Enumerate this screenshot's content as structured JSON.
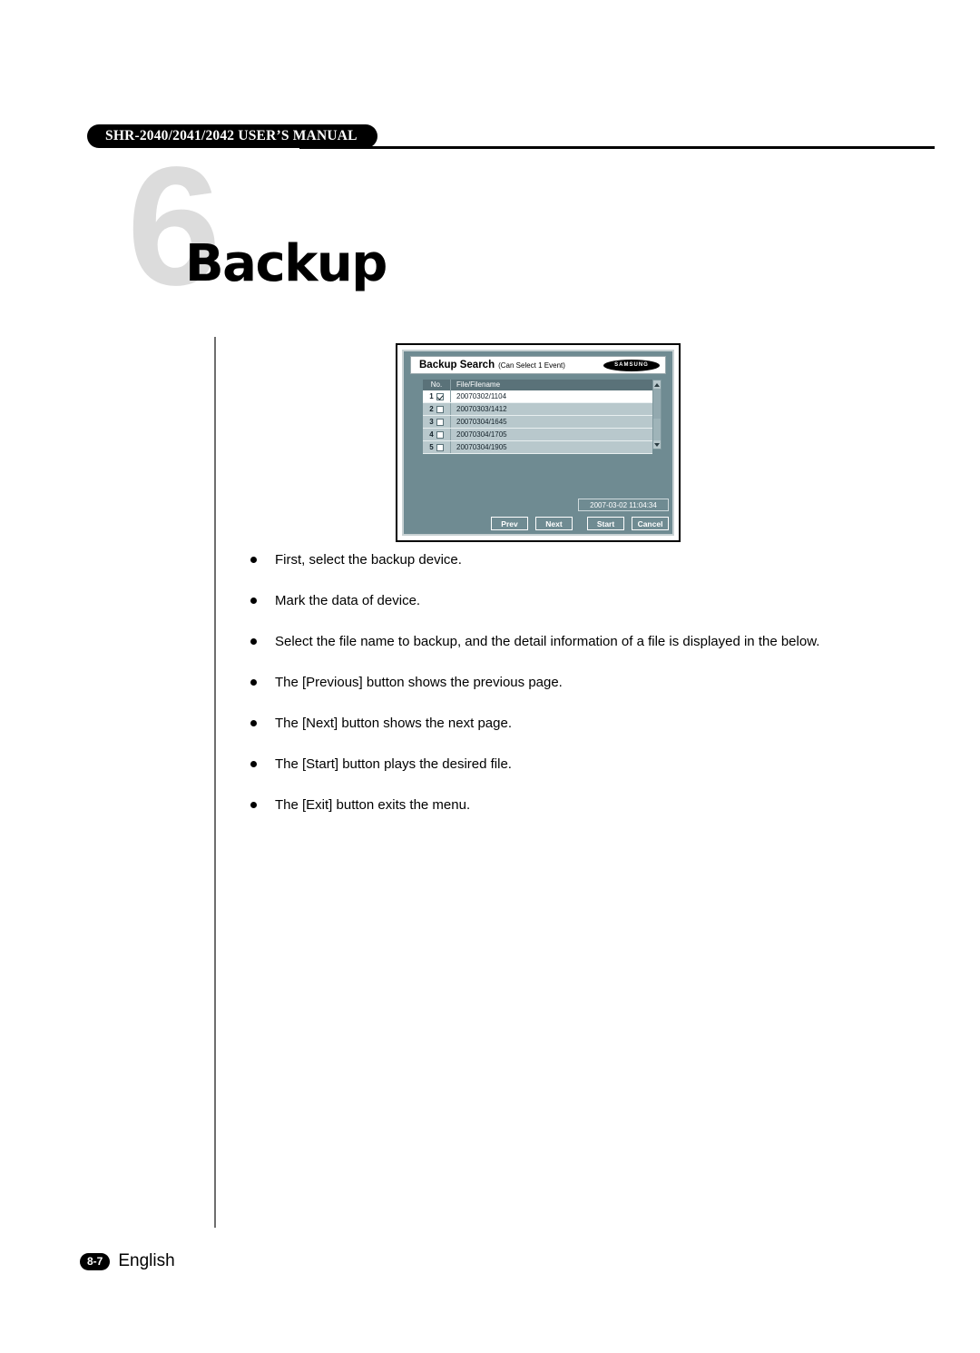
{
  "header": {
    "manual_title": "SHR-2040/2041/2042 USER’S MANUAL"
  },
  "chapter": {
    "number": "6",
    "title": "Backup"
  },
  "dialog": {
    "title": "Backup Search",
    "subtitle": "(Can Select 1 Event)",
    "brand": "SAMSUNG",
    "columns": {
      "no": "No.",
      "file": "File/Filename"
    },
    "rows": [
      {
        "no": "1",
        "filename": "20070302/1104",
        "checked": true
      },
      {
        "no": "2",
        "filename": "20070303/1412",
        "checked": false
      },
      {
        "no": "3",
        "filename": "20070304/1645",
        "checked": false
      },
      {
        "no": "4",
        "filename": "20070304/1705",
        "checked": false
      },
      {
        "no": "5",
        "filename": "20070304/1905",
        "checked": false
      }
    ],
    "timestamp": "2007-03-02  11:04:34",
    "buttons": {
      "prev": "Prev",
      "next": "Next",
      "start": "Start",
      "cancel": "Cancel"
    }
  },
  "bullets": [
    "First, select the backup device.",
    "Mark the data of device.",
    "Select the file name to backup, and the detail information of a file is displayed in the below.",
    "The [Previous] button shows the previous page.",
    "The [Next] button shows the next page.",
    "The [Start] button plays the desired file.",
    "The [Exit] button exits the menu."
  ],
  "footer": {
    "page": "8-7",
    "language": "English"
  },
  "colors": {
    "dialog_body": "#6f8b92",
    "table_header": "#5a7279",
    "table_row": "#b8c8cc",
    "chapter_number": "#dcdcdc"
  }
}
